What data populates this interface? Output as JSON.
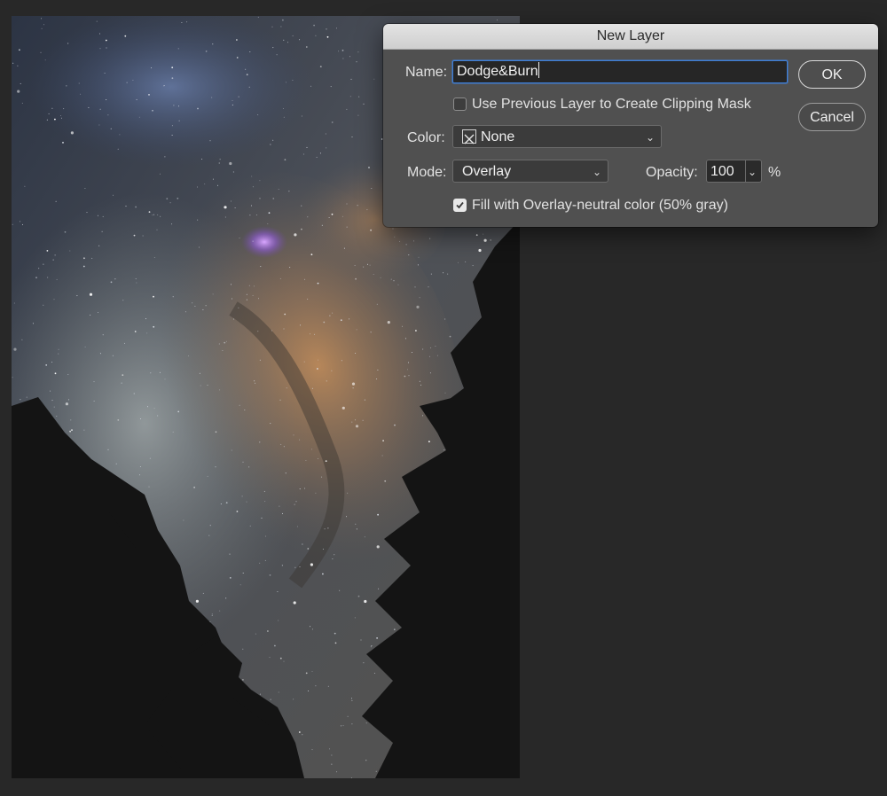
{
  "dialog": {
    "title": "New Layer",
    "name_label": "Name:",
    "name_value": "Dodge&Burn",
    "clipping_mask_label": "Use Previous Layer to Create Clipping Mask",
    "clipping_mask_checked": false,
    "color_label": "Color:",
    "color_value": "None",
    "mode_label": "Mode:",
    "mode_value": "Overlay",
    "opacity_label": "Opacity:",
    "opacity_value": "100",
    "opacity_unit": "%",
    "fill_neutral_label": "Fill with Overlay-neutral color (50% gray)",
    "fill_neutral_checked": true,
    "ok_label": "OK",
    "cancel_label": "Cancel"
  },
  "icons": {
    "color_swatch": "no-color-x-icon",
    "dropdown": "chevron-down-icon",
    "checkmark": "checkmark-icon"
  },
  "colors": {
    "workspace_bg": "#282828",
    "dialog_bg": "#505050",
    "focus_ring": "#3f7fd9"
  }
}
